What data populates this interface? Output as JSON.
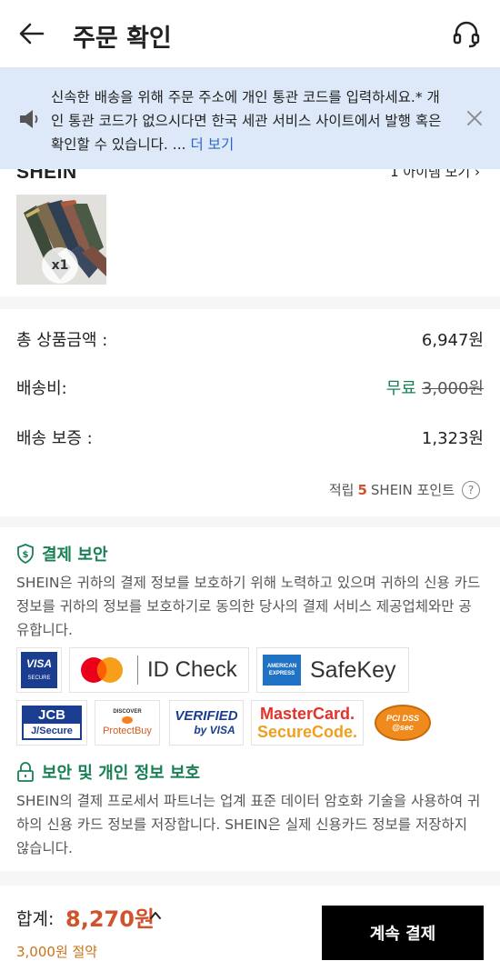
{
  "header": {
    "title": "주문 확인",
    "back_icon": "arrow-left-icon",
    "support_icon": "headset-icon"
  },
  "banner": {
    "text": "신속한 배송을 위해 주문 주소에 개인 통관 코드를 입력하세요.* 개인 통관 코드가 없으시다면 한국 세관 서비스 사이트에서 발행 혹은 확인할 수 있습니다. ... ",
    "more_label": "더 보기",
    "speaker_icon": "speaker-icon",
    "close_icon": "close-icon"
  },
  "shop": {
    "name": "SHEIN",
    "items_link": "1 아이템 보기",
    "quantity": "x1"
  },
  "summary": {
    "subtotal_label": "총 상품금액 :",
    "subtotal_value": "6,947원",
    "shipping_label": "배송비:",
    "shipping_free": "무료",
    "shipping_original": "3,000원",
    "guarantee_label": "배송 보증 :",
    "guarantee_value": "1,323원",
    "points_prefix": "적립",
    "points_value": "5",
    "points_suffix": "SHEIN 포인트",
    "points_help": "?"
  },
  "security": {
    "payment_title": "결제 보안",
    "payment_body": "SHEIN은 귀하의 결제 정보를 보호하기 위해 노력하고 있으며 귀하의 신용 카드 정보를 귀하의 정보를 보호하기로 동의한 당사의 결제 서비스 제공업체와만 공유합니다.",
    "privacy_title": "보안 및 개인 정보 보호",
    "privacy_body": "SHEIN의 결제 프로세서 파트너는 업계 표준 데이터 암호화 기술을 사용하여 귀하의 신용 카드 정보를 저장합니다. SHEIN은 실제 신용카드 정보를 저장하지 않습니다.",
    "badges": {
      "visa_top": "VISA",
      "visa_bottom": "SECURE",
      "id_check": "ID Check",
      "amex_top": "AMERICAN",
      "amex_bottom": "EXPRESS",
      "safekey": "SafeKey",
      "jcb_top": "JCB",
      "jcb_bottom": "J/Secure",
      "discover_top": "DISCOVER",
      "discover_bottom": "ProtectBuy",
      "verified_top": "VERIFIED",
      "verified_bottom": "by VISA",
      "mc_top": "MasterCard.",
      "mc_bottom": "SecureCode.",
      "pci_top": "PCI DSS",
      "pci_bottom": "@sec"
    }
  },
  "footer": {
    "total_label": "합계:",
    "total_amount": "8,270원",
    "saved": "3,000원 절약",
    "pay_button": "계속 결제"
  },
  "colors": {
    "accent_orange": "#d0532e",
    "free_green": "#198055",
    "banner_bg": "#dde9f8",
    "link_blue": "#2d68c4"
  }
}
